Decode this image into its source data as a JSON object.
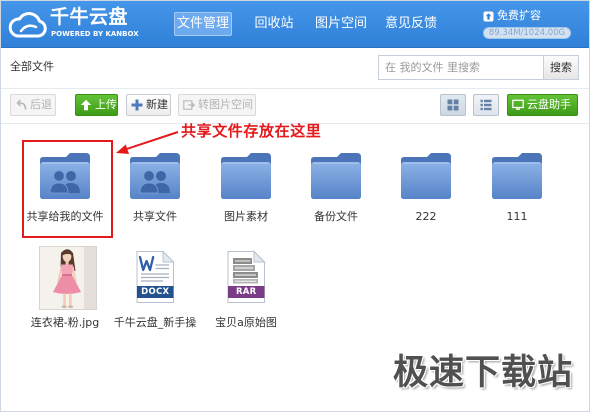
{
  "app": {
    "title": "千牛云盘",
    "subtitle": "POWERED BY KANBOX",
    "logo_icon": "cloud-logo-icon"
  },
  "nav": {
    "tabs": [
      {
        "label": "文件管理",
        "active": true
      },
      {
        "label": "回收站",
        "active": false
      },
      {
        "label": "图片空间",
        "active": false
      },
      {
        "label": "意见反馈",
        "active": false
      }
    ]
  },
  "account": {
    "expand_icon": "expand-storage-icon",
    "expand_label": "免费扩容",
    "storage_text": "89.34M/1024.00G"
  },
  "breadcrumb": {
    "current": "全部文件"
  },
  "search": {
    "placeholder": "在 我的文件 里搜索",
    "button_label": "搜索"
  },
  "toolbar": {
    "back": {
      "label": "后退",
      "icon": "back-arrow-icon",
      "enabled": false
    },
    "upload": {
      "label": "上传",
      "icon": "upload-arrow-icon",
      "enabled": true
    },
    "new": {
      "label": "新建",
      "icon": "plus-icon",
      "enabled": true
    },
    "to_image_space": {
      "label": "转图片空间",
      "icon": "image-space-icon",
      "enabled": false
    },
    "grid_view": {
      "icon": "grid-view-icon",
      "selected": true
    },
    "list_view": {
      "icon": "list-view-icon",
      "selected": false
    },
    "helper": {
      "label": "云盘助手",
      "icon": "monitor-icon"
    }
  },
  "files": [
    {
      "name": "共享给我的文件",
      "icon": "shared-folder-icon"
    },
    {
      "name": "共享文件",
      "icon": "shared-folder-icon"
    },
    {
      "name": "图片素材",
      "icon": "folder-icon"
    },
    {
      "name": "备份文件",
      "icon": "folder-icon"
    },
    {
      "name": "222",
      "icon": "folder-icon"
    },
    {
      "name": "111",
      "icon": "folder-icon"
    },
    {
      "name": "连衣裙-粉.jpg",
      "icon": "image-thumbnail"
    },
    {
      "name": "千牛云盘_新手操",
      "icon": "docx-file-icon",
      "badge": "DOCX"
    },
    {
      "name": "宝贝a原始图",
      "icon": "rar-file-icon",
      "badge": "RAR"
    }
  ],
  "annotation": {
    "text": "共享文件存放在这里"
  },
  "watermark": {
    "text": "极速下载站"
  },
  "colors": {
    "header_blue": "#3b8be4",
    "tab_active_bg": "#6eaaee",
    "button_green": "#47a51d",
    "annotation_red": "#e3191b",
    "folder_blue": "#5b87c9",
    "docx_band": "#24528f",
    "rar_band": "#7b3c87",
    "watermark_grey": "#505050"
  }
}
